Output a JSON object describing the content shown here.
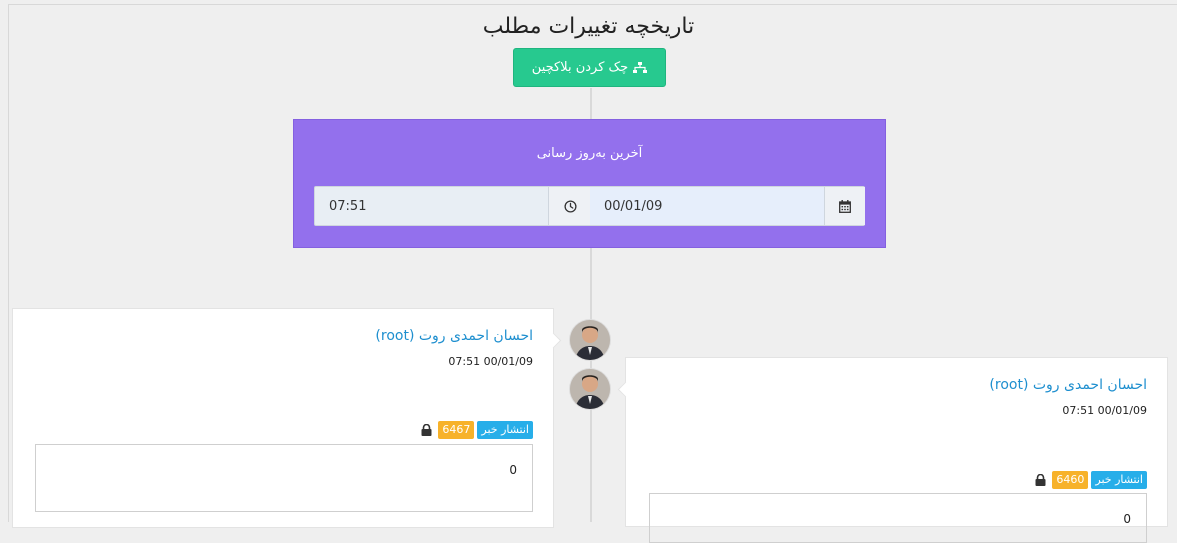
{
  "page": {
    "title": "تاریخچه تغییرات مطلب"
  },
  "toolbar": {
    "blockchain_label": "چک کردن بلاکچین"
  },
  "update_panel": {
    "title": "آخرین به‌روز رسانی",
    "time": "07:51",
    "date": "00/01/09"
  },
  "entries": [
    {
      "author": "احسان احمدی روت (root)",
      "timestamp": "07:51 00/01/09",
      "badge_label": "انتشار خبر",
      "badge_count": "6467",
      "value": "0"
    },
    {
      "author": "احسان احمدی روت (root)",
      "timestamp": "07:51 00/01/09",
      "badge_label": "انتشار خبر",
      "badge_count": "6460",
      "value": "0"
    }
  ],
  "colors": {
    "accent_green": "#27c98f",
    "panel_purple": "#9370ed",
    "link_blue": "#1e8fcf",
    "badge_blue": "#27aee9",
    "badge_orange": "#f7b22a"
  },
  "icons": [
    "sitemap-icon",
    "clock-icon",
    "calendar-icon",
    "lock-icon"
  ]
}
